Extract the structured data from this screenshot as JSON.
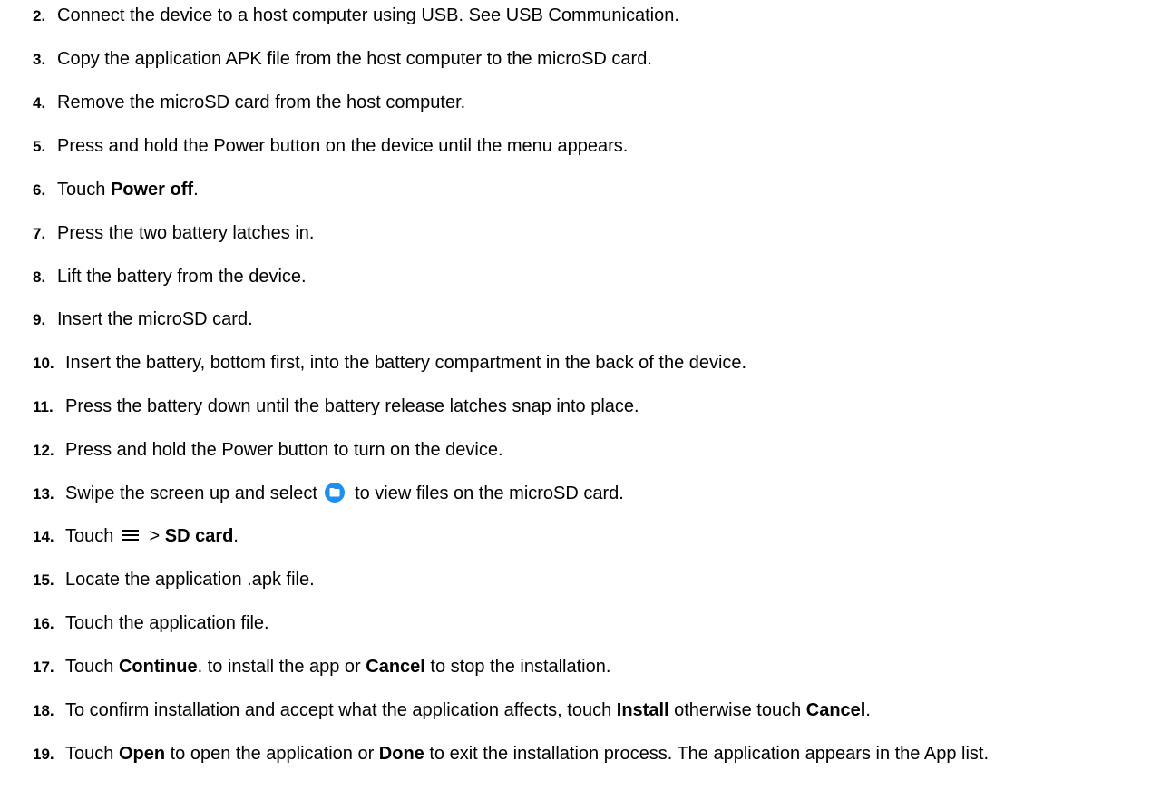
{
  "steps": [
    {
      "num": "2.",
      "parts": [
        {
          "t": "Connect the device to a host computer using USB. See USB Communication."
        }
      ]
    },
    {
      "num": "3.",
      "parts": [
        {
          "t": "Copy the application APK file from the host computer to the microSD card."
        }
      ]
    },
    {
      "num": "4.",
      "parts": [
        {
          "t": "Remove the microSD card from the host computer."
        }
      ]
    },
    {
      "num": "5.",
      "parts": [
        {
          "t": "Press and hold the Power button on the device until the menu appears."
        }
      ]
    },
    {
      "num": "6.",
      "parts": [
        {
          "t": "Touch "
        },
        {
          "t": "Power off",
          "b": true
        },
        {
          "t": "."
        }
      ]
    },
    {
      "num": "7.",
      "parts": [
        {
          "t": "Press the two battery latches in."
        }
      ]
    },
    {
      "num": "8.",
      "parts": [
        {
          "t": "Lift the battery from the device."
        }
      ]
    },
    {
      "num": "9.",
      "parts": [
        {
          "t": "Insert the microSD card."
        }
      ]
    },
    {
      "num": "10.",
      "parts": [
        {
          "t": "Insert the battery, bottom first, into the battery compartment in the back of the device."
        }
      ]
    },
    {
      "num": "11.",
      "parts": [
        {
          "t": "Press the battery down until the battery release latches snap into place."
        }
      ]
    },
    {
      "num": "12.",
      "parts": [
        {
          "t": "Press and hold the Power button to turn on the device."
        }
      ]
    },
    {
      "num": "13.",
      "parts": [
        {
          "t": "Swipe the screen up and select "
        },
        {
          "icon": "folder-icon"
        },
        {
          "t": " to view files on the microSD card."
        }
      ]
    },
    {
      "num": "14.",
      "parts": [
        {
          "t": "Touch "
        },
        {
          "icon": "menu-icon"
        },
        {
          "t": " > "
        },
        {
          "t": "SD card",
          "b": true
        },
        {
          "t": "."
        }
      ]
    },
    {
      "num": "15.",
      "parts": [
        {
          "t": "Locate the application .apk file."
        }
      ]
    },
    {
      "num": "16.",
      "parts": [
        {
          "t": "Touch the application file."
        }
      ]
    },
    {
      "num": "17.",
      "parts": [
        {
          "t": "Touch "
        },
        {
          "t": "Continue",
          "b": true
        },
        {
          "t": ". to install the app or "
        },
        {
          "t": "Cancel",
          "b": true
        },
        {
          "t": " to stop the installation."
        }
      ]
    },
    {
      "num": "18.",
      "parts": [
        {
          "t": "To confirm installation and accept what the application affects, touch "
        },
        {
          "t": "Install",
          "b": true
        },
        {
          "t": " otherwise touch "
        },
        {
          "t": "Cancel",
          "b": true
        },
        {
          "t": "."
        }
      ]
    },
    {
      "num": "19.",
      "parts": [
        {
          "t": "Touch "
        },
        {
          "t": "Open",
          "b": true
        },
        {
          "t": " to open the application or "
        },
        {
          "t": "Done",
          "b": true
        },
        {
          "t": " to exit the installation process. The application appears in the App list."
        }
      ]
    }
  ],
  "colors": {
    "text": "#000000",
    "folder_icon": "#1e8ff0"
  }
}
